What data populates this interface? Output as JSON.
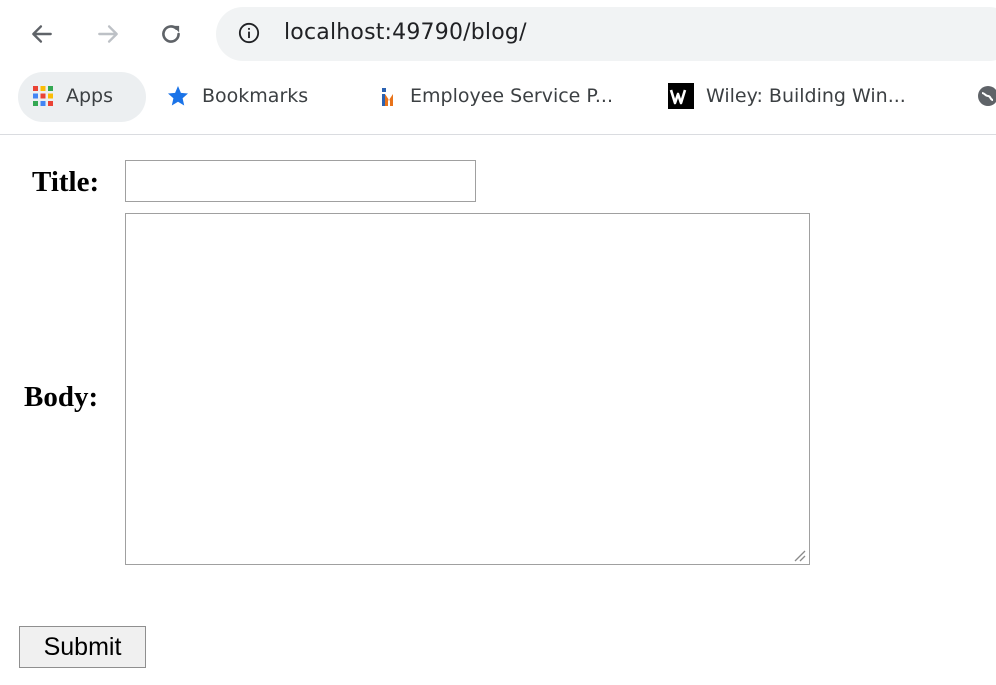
{
  "browser": {
    "url": "localhost:49790/blog/",
    "bookmarks": [
      {
        "label": "Apps",
        "icon": "apps-grid-icon"
      },
      {
        "label": "Bookmarks",
        "icon": "star-icon"
      },
      {
        "label": "Employee Service P...",
        "icon": "employee-service-favicon"
      },
      {
        "label": "Wiley: Building Win...",
        "icon": "wiley-favicon"
      }
    ],
    "colors": {
      "star": "#1a73e8",
      "omnibox": "#f1f3f4"
    }
  },
  "form": {
    "title_label": "Title:",
    "title_value": "",
    "body_label": "Body:",
    "body_value": "",
    "submit_label": "Submit"
  }
}
